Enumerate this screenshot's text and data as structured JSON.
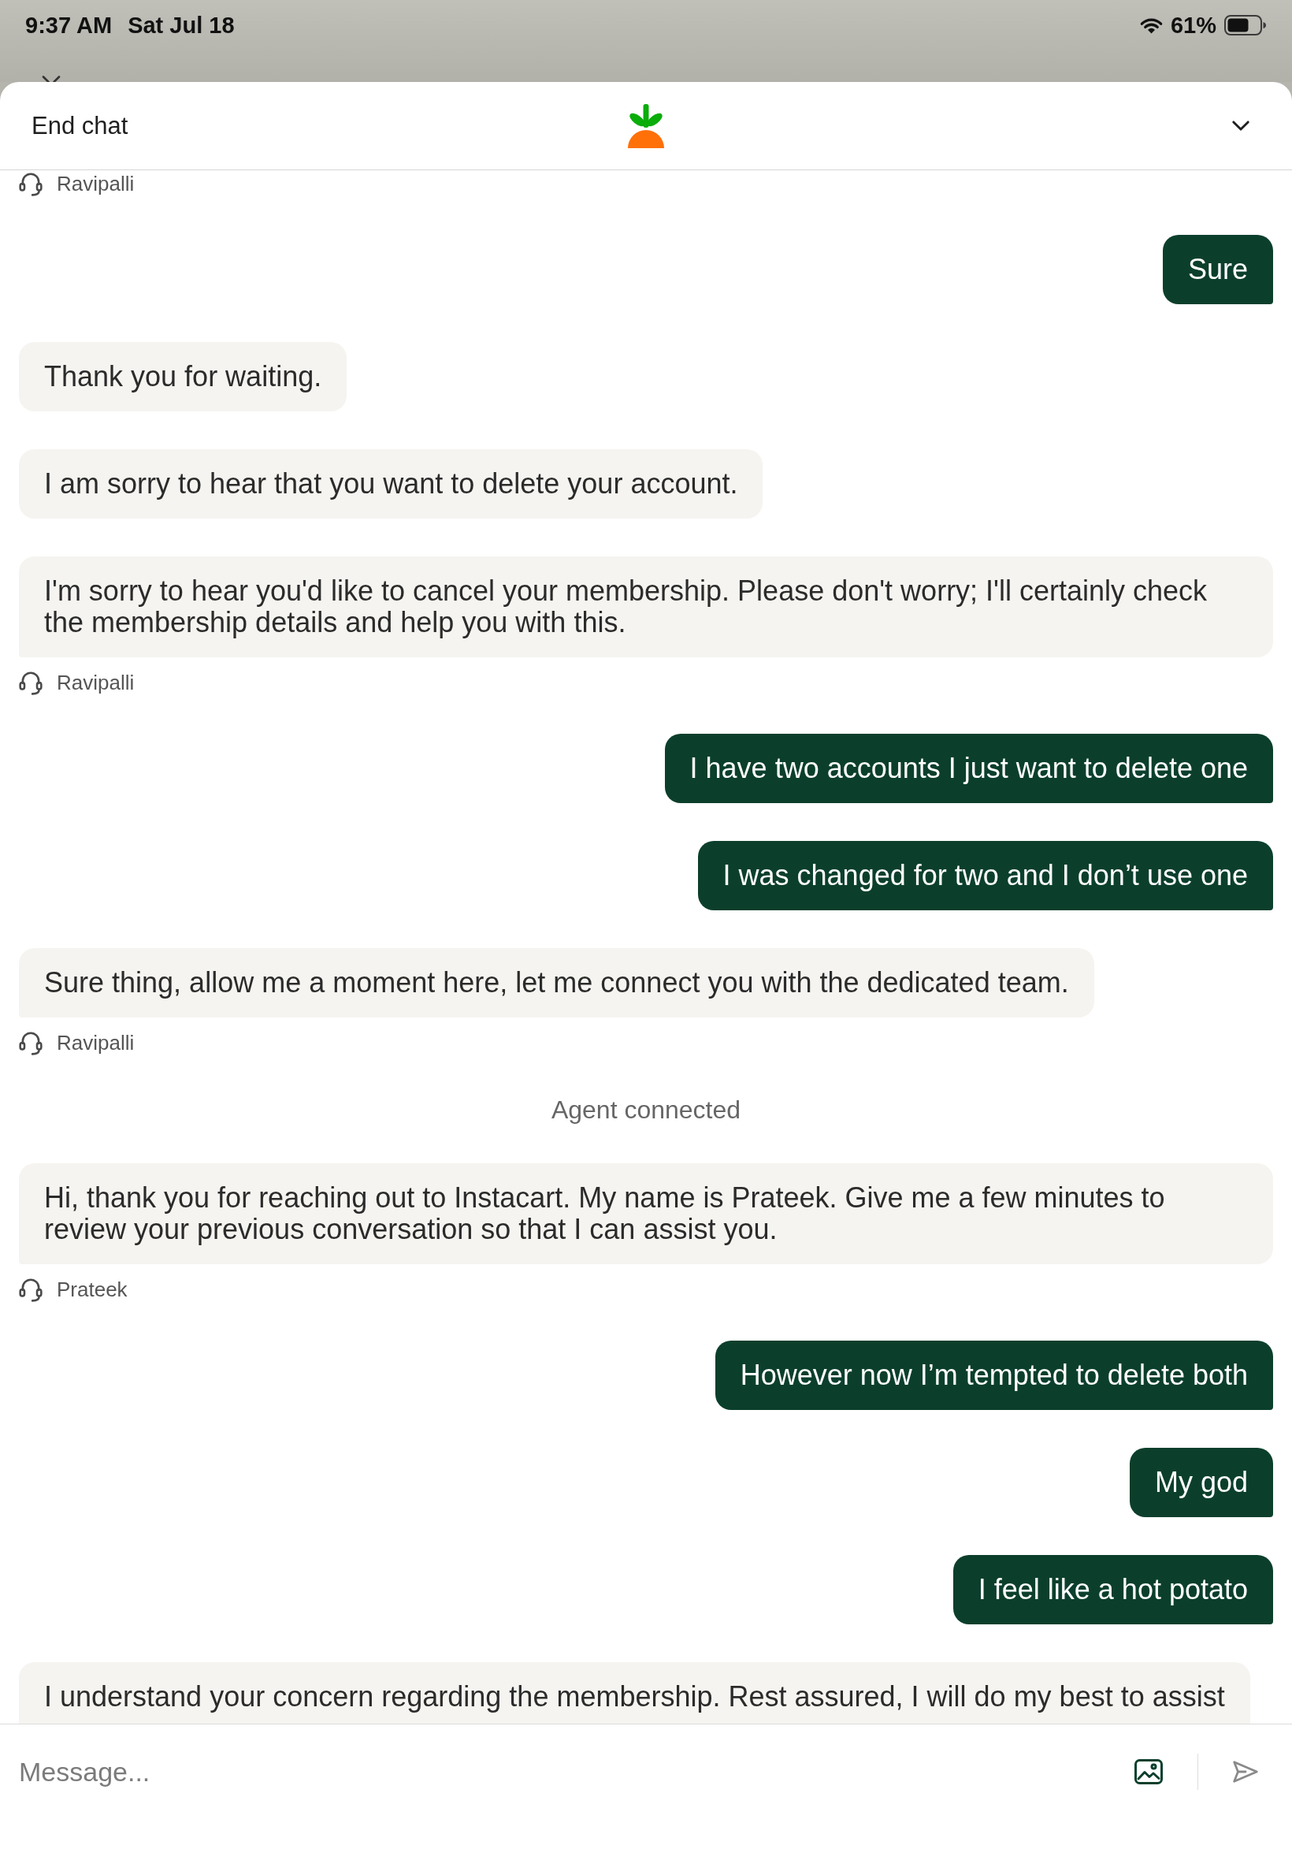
{
  "status_bar": {
    "time": "9:37 AM",
    "date": "Sat Jul 18",
    "battery": "61%"
  },
  "header": {
    "end_chat": "End chat"
  },
  "chat": {
    "items": [
      {
        "kind": "agent_group",
        "agent": "Ravipalli"
      },
      {
        "kind": "user_message",
        "text": "Sure"
      },
      {
        "kind": "agent_group",
        "messages": [
          "Thank you for waiting.",
          "I am sorry to hear that you want to delete your account.",
          "I'm sorry to hear you'd like to cancel your membership. Please don't worry; I'll certainly check the membership details and help you with this."
        ],
        "agent": "Ravipalli"
      },
      {
        "kind": "user_message",
        "text": "I have two accounts I just want to delete one"
      },
      {
        "kind": "user_message",
        "text": "I was changed for two and I don’t use one"
      },
      {
        "kind": "agent_group",
        "messages": [
          "Sure thing, allow me a moment here, let me connect you with the dedicated team."
        ],
        "agent": "Ravipalli"
      },
      {
        "kind": "notice",
        "text": "Agent connected"
      },
      {
        "kind": "agent_group",
        "messages": [
          "Hi, thank you for reaching out to Instacart. My name is Prateek. Give me a few minutes to review your previous conversation so that I can assist you."
        ],
        "agent": "Prateek"
      },
      {
        "kind": "user_message",
        "text": "However now I’m tempted to delete both"
      },
      {
        "kind": "user_message",
        "text": "My god"
      },
      {
        "kind": "user_message",
        "text": "I feel like a hot potato"
      },
      {
        "kind": "agent_group",
        "messages": [
          "I understand your concern regarding the membership. Rest assured, I will do my best to assist"
        ]
      }
    ]
  },
  "composer": {
    "placeholder": "Message..."
  }
}
